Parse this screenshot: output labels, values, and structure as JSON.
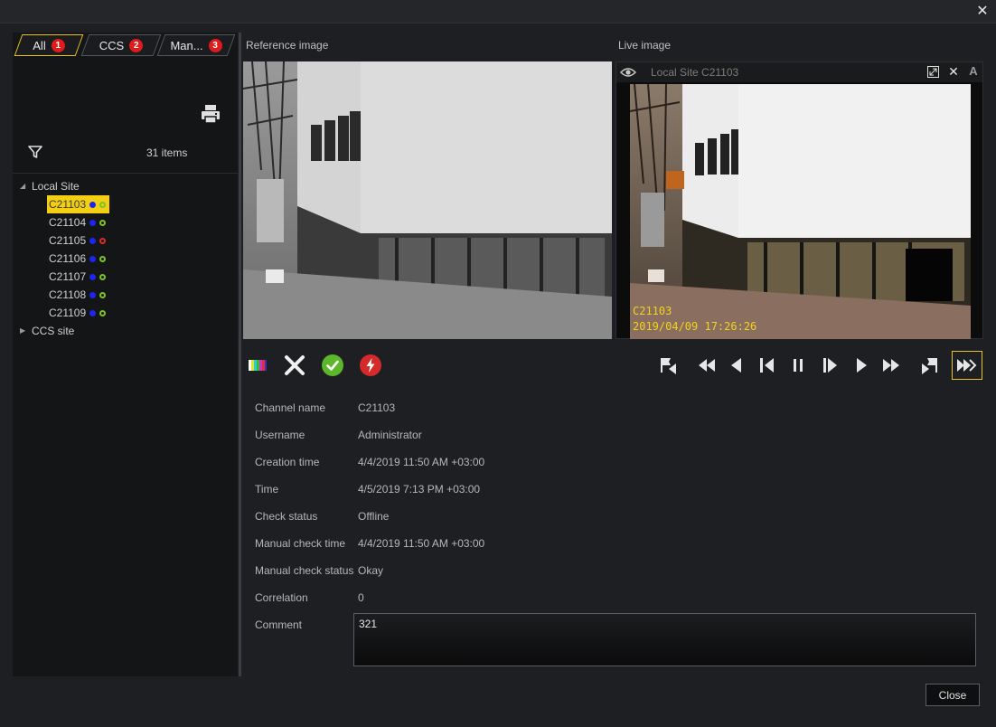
{
  "window": {
    "close_glyph": "✕"
  },
  "tabs": [
    {
      "label": "All",
      "badge": "1",
      "active": true
    },
    {
      "label": "CCS",
      "badge": "2",
      "active": false
    },
    {
      "label": "Man...",
      "badge": "3",
      "active": false
    }
  ],
  "list": {
    "items_count": "31 items"
  },
  "tree": {
    "sites": [
      {
        "label": "Local Site",
        "expanded": true,
        "channels": [
          {
            "name": "C21103",
            "selected": true,
            "status": "green"
          },
          {
            "name": "C21104",
            "selected": false,
            "status": "green"
          },
          {
            "name": "C21105",
            "selected": false,
            "status": "red"
          },
          {
            "name": "C21106",
            "selected": false,
            "status": "green"
          },
          {
            "name": "C21107",
            "selected": false,
            "status": "green"
          },
          {
            "name": "C21108",
            "selected": false,
            "status": "green"
          },
          {
            "name": "C21109",
            "selected": false,
            "status": "green"
          }
        ]
      },
      {
        "label": "CCS site",
        "expanded": false
      }
    ]
  },
  "images": {
    "reference_label": "Reference image",
    "live_label": "Live image",
    "live_title": "Local Site C21103",
    "live_overlay_camera": "C21103",
    "live_overlay_timestamp": "2019/04/09 17:26:26",
    "live_a_glyph": "A",
    "live_x_glyph": "✕"
  },
  "details": {
    "rows": [
      {
        "label": "Channel name",
        "value": "C21103"
      },
      {
        "label": "Username",
        "value": "Administrator"
      },
      {
        "label": "Creation time",
        "value": "4/4/2019 11:50 AM +03:00"
      },
      {
        "label": "Time",
        "value": "4/5/2019 7:13 PM +03:00"
      },
      {
        "label": "Check status",
        "value": "Offline"
      },
      {
        "label": "Manual check time",
        "value": "4/4/2019 11:50 AM +03:00"
      },
      {
        "label": "Manual check status",
        "value": "Okay"
      },
      {
        "label": "Correlation",
        "value": "0"
      },
      {
        "label": "Comment",
        "value": ""
      }
    ],
    "comment_text": "321"
  },
  "footer": {
    "close_label": "Close"
  },
  "colors": {
    "accent": "#e9c31b",
    "badge": "#e01b1b",
    "status_green": "#7cc22a",
    "status_red": "#e02a2a",
    "status_blue": "#1c26f0"
  }
}
